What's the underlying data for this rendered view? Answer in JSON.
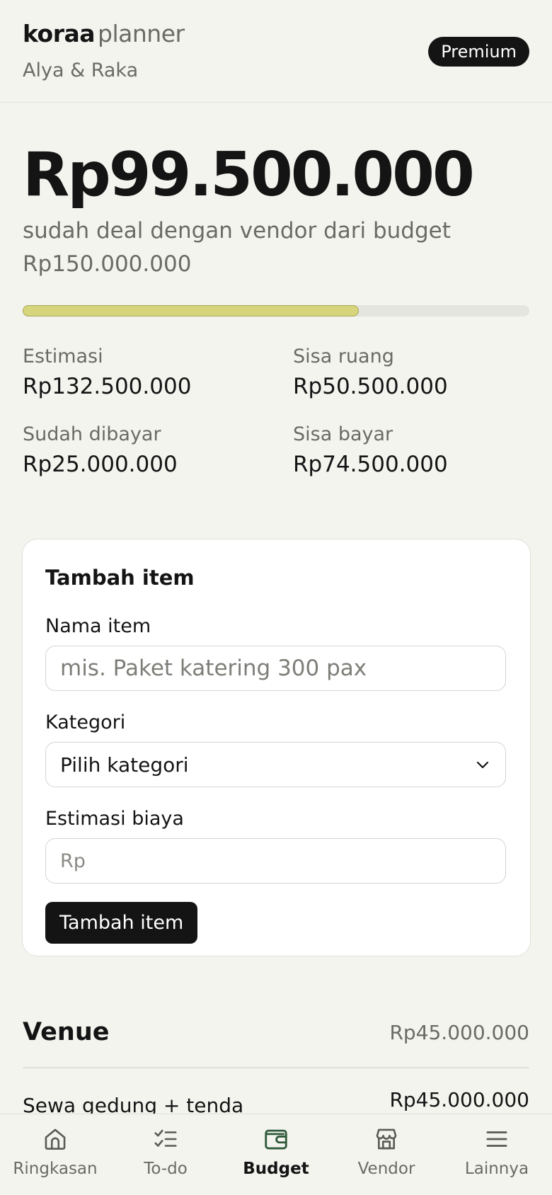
{
  "header": {
    "brand_bold": "koraa",
    "brand_light": "planner",
    "couple": "Alya & Raka",
    "badge": "Premium"
  },
  "summary": {
    "deal_total": "Rp99.500.000",
    "subtitle": "sudah deal dengan vendor dari budget Rp150.000.000",
    "progress_fraction": 0.663,
    "stats": [
      {
        "label": "Estimasi",
        "value": "Rp132.500.000"
      },
      {
        "label": "Sisa ruang",
        "value": "Rp50.500.000"
      },
      {
        "label": "Sudah dibayar",
        "value": "Rp25.000.000"
      },
      {
        "label": "Sisa bayar",
        "value": "Rp74.500.000"
      }
    ]
  },
  "form": {
    "title": "Tambah item",
    "name_label": "Nama item",
    "name_placeholder": "mis. Paket katering 300 pax",
    "category_label": "Kategori",
    "category_value": "Pilih kategori",
    "cost_label": "Estimasi biaya",
    "cost_placeholder": "Rp",
    "submit_label": "Tambah item"
  },
  "sections": [
    {
      "title": "Venue",
      "total": "Rp45.000.000",
      "items": [
        {
          "name": "Sewa gedung + tenda",
          "value": "Rp45.000.000"
        }
      ]
    }
  ],
  "tabbar": {
    "active": "budget",
    "tabs": [
      {
        "id": "ringkasan",
        "label": "Ringkasan",
        "icon": "home-icon"
      },
      {
        "id": "todo",
        "label": "To-do",
        "icon": "checklist-icon"
      },
      {
        "id": "budget",
        "label": "Budget",
        "icon": "wallet-icon"
      },
      {
        "id": "vendor",
        "label": "Vendor",
        "icon": "store-icon"
      },
      {
        "id": "lainnya",
        "label": "Lainnya",
        "icon": "menu-icon"
      }
    ]
  },
  "colors": {
    "accent_fill": "#d7d57c",
    "active_icon": "#2f5a3a",
    "background": "#f4f4ef"
  }
}
